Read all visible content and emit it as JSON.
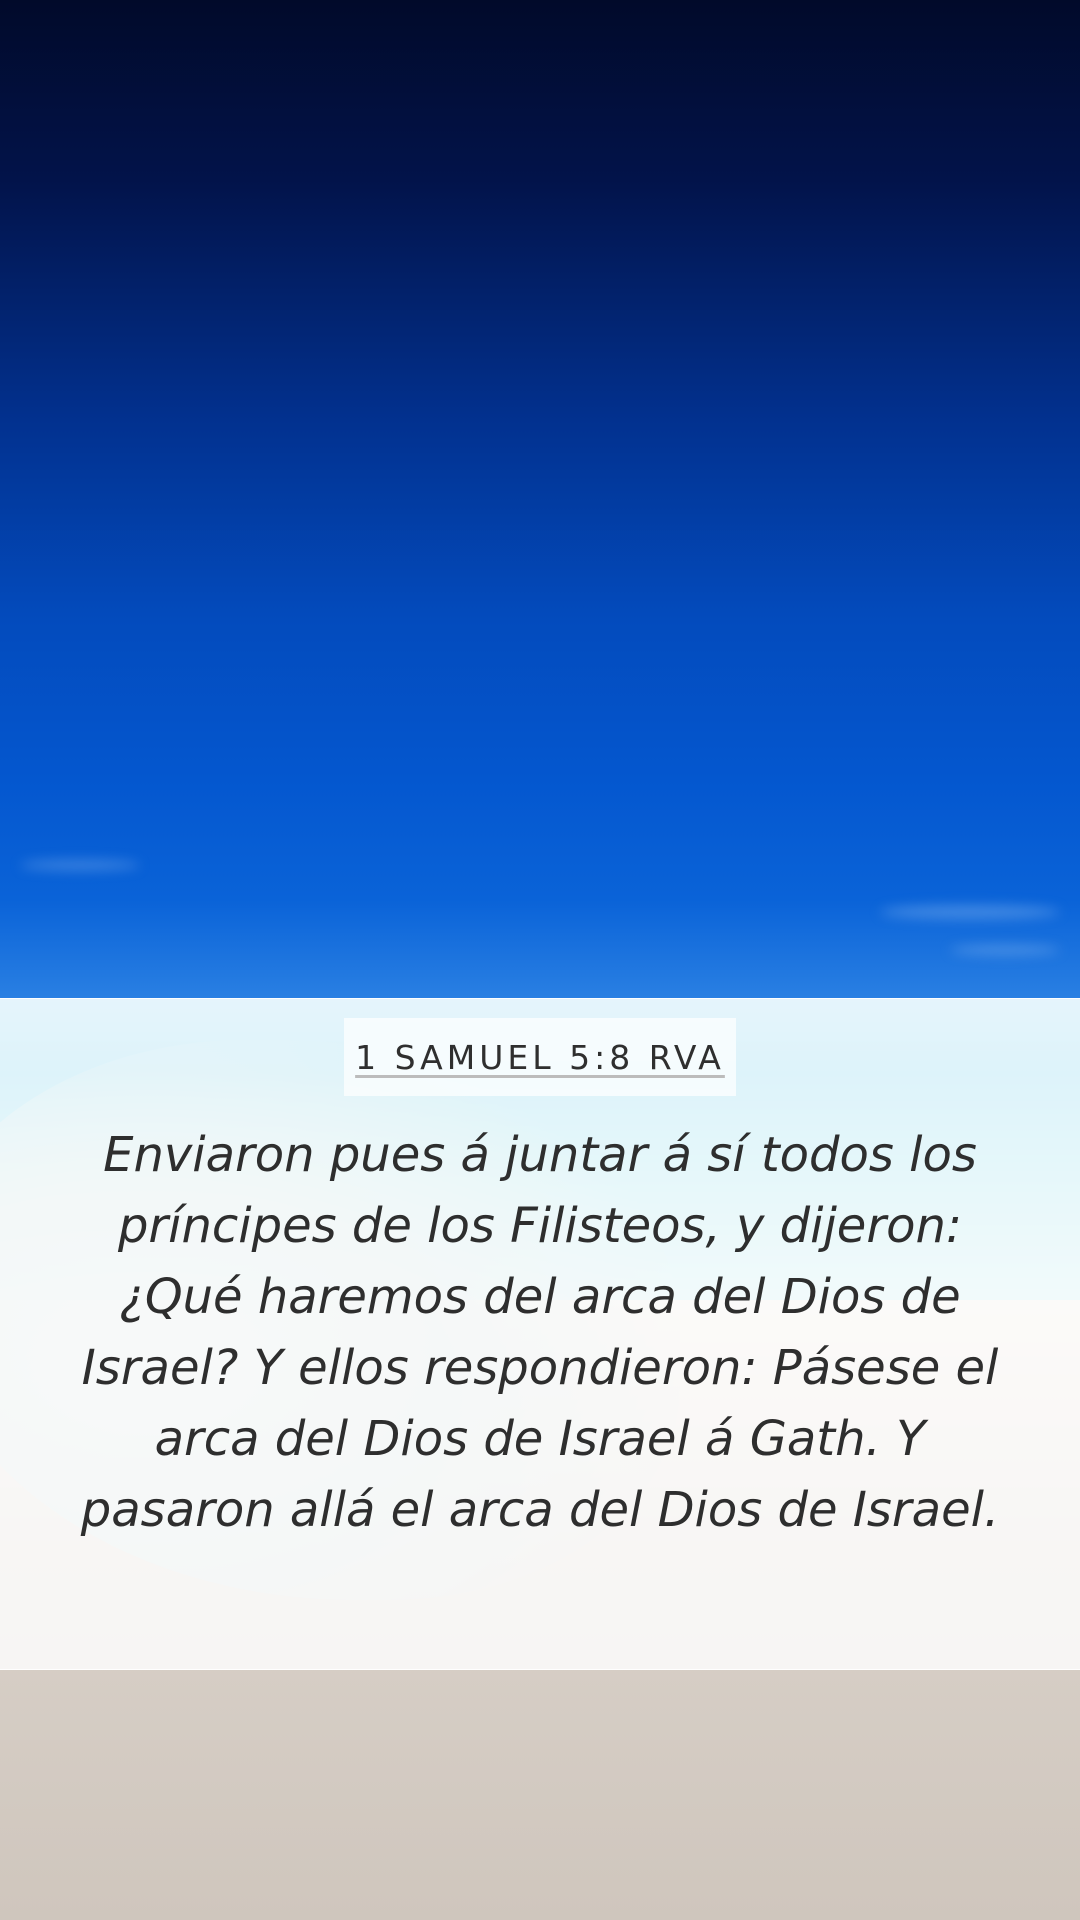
{
  "reference": "1 SAMUEL 5:8 RVA",
  "verse_text": "Enviaron pues á juntar á sí todos los príncipes de los Filisteos, y dijeron: ¿Qué haremos del arca del Dios de Israel? Y ellos respondieron: Pásese el arca del Dios de Israel á Gath. Y pasaron allá el arca del Dios de Israel.",
  "colors": {
    "sky_top": "#010a2a",
    "sky_bottom": "#0457cf",
    "text": "#2e2e2e"
  }
}
